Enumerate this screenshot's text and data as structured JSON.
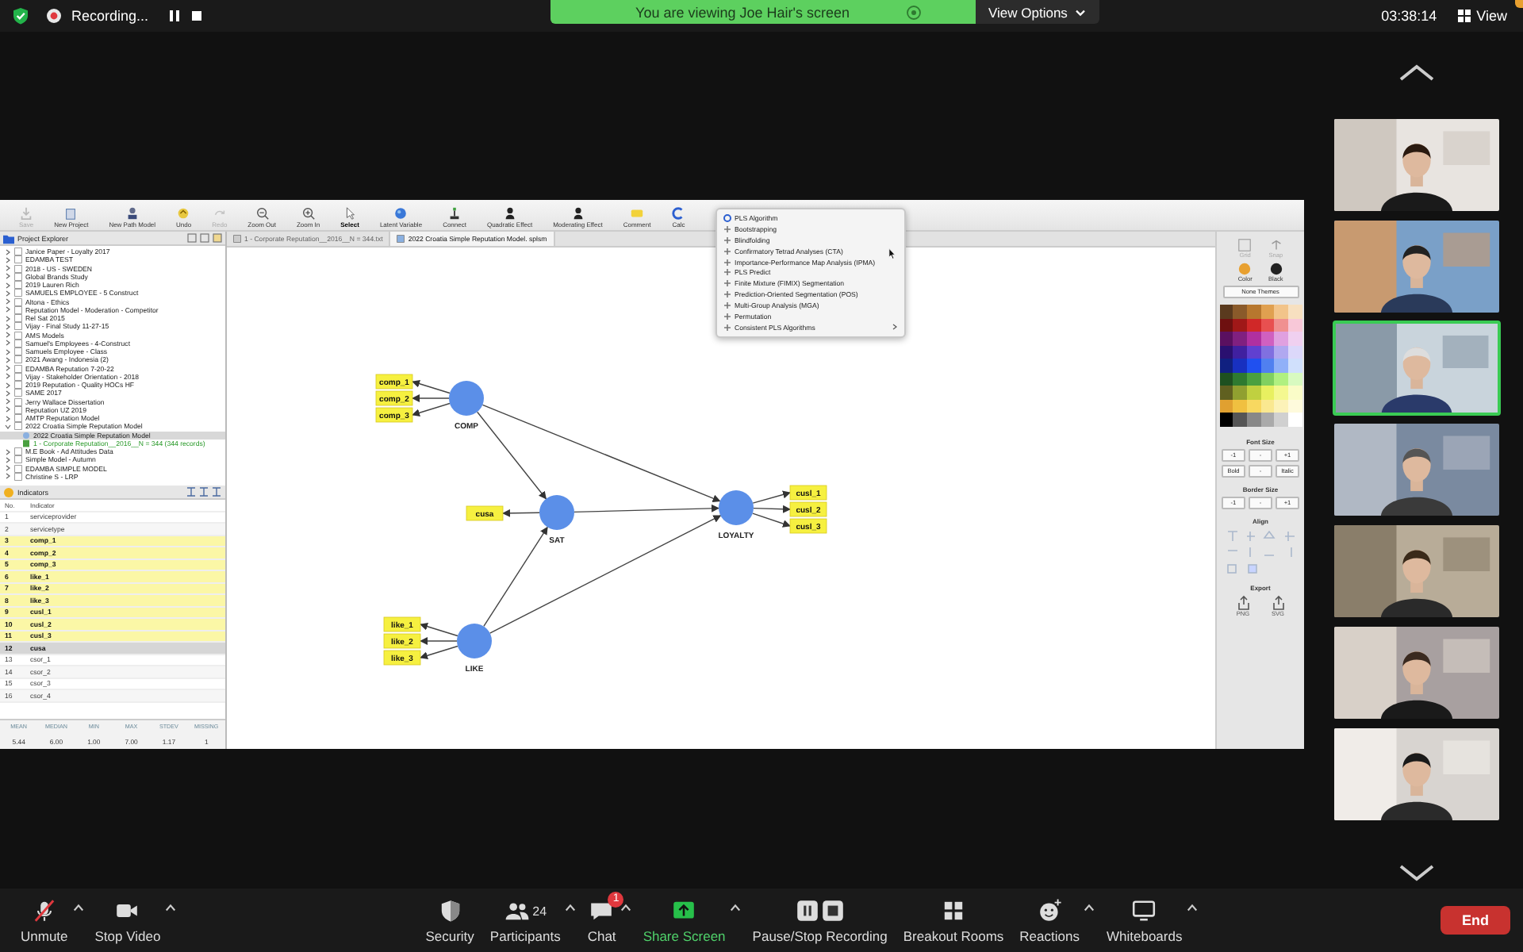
{
  "top_bar": {
    "recording_label": "Recording...",
    "banner": "You are viewing Joe Hair's screen",
    "view_options": "View Options",
    "time": "03:38:14",
    "view": "View"
  },
  "smartpls": {
    "toolbar": [
      {
        "label": "Save",
        "disabled": true,
        "selected": false
      },
      {
        "label": "New Project",
        "disabled": false,
        "selected": false
      },
      {
        "label": "New Path Model",
        "disabled": false,
        "selected": false
      },
      {
        "label": "Undo",
        "disabled": false,
        "selected": false
      },
      {
        "label": "Redo",
        "disabled": true,
        "selected": false
      },
      {
        "label": "Zoom Out",
        "disabled": false,
        "selected": false
      },
      {
        "label": "Zoom In",
        "disabled": false,
        "selected": false
      },
      {
        "label": "Select",
        "disabled": false,
        "selected": true
      },
      {
        "label": "Latent Variable",
        "disabled": false,
        "selected": false
      },
      {
        "label": "Connect",
        "disabled": false,
        "selected": false
      },
      {
        "label": "Quadratic Effect",
        "disabled": false,
        "selected": false
      },
      {
        "label": "Moderating Effect",
        "disabled": false,
        "selected": false
      },
      {
        "label": "Comment",
        "disabled": false,
        "selected": false
      },
      {
        "label": "Calc",
        "disabled": false,
        "selected": false
      }
    ],
    "project_explorer": {
      "title": "Project Explorer",
      "projects": [
        {
          "label": "Janice Paper - Loyalty 2017",
          "expanded": false
        },
        {
          "label": "EDAMBA TEST",
          "expanded": false
        },
        {
          "label": "2018 - US - SWEDEN",
          "expanded": false
        },
        {
          "label": "Global Brands Study",
          "expanded": false
        },
        {
          "label": "2019 Lauren Rich",
          "expanded": false
        },
        {
          "label": "SAMUELS EMPLOYEE - 5 Construct",
          "expanded": false
        },
        {
          "label": "Altona - Ethics",
          "expanded": false
        },
        {
          "label": "Reputation Model - Moderation - Competitor",
          "expanded": false
        },
        {
          "label": "Rel Sat 2015",
          "expanded": false
        },
        {
          "label": "Vijay - Final Study 11-27-15",
          "expanded": false
        },
        {
          "label": "AMS Models",
          "expanded": false
        },
        {
          "label": "Samuel's Employees - 4-Construct",
          "expanded": false
        },
        {
          "label": "Samuels Employee - Class",
          "expanded": false
        },
        {
          "label": "2021 Awang - Indonesia (2)",
          "expanded": false
        },
        {
          "label": "EDAMBA Reputation 7-20-22",
          "expanded": false
        },
        {
          "label": "Vijay - Stakeholder Orientation - 2018",
          "expanded": false
        },
        {
          "label": "2019 Reputation - Quality HOCs HF",
          "expanded": false
        },
        {
          "label": "SAME 2017",
          "expanded": false
        },
        {
          "label": "Jerry Wallace Dissertation",
          "expanded": false
        },
        {
          "label": "Reputation UZ 2019",
          "expanded": false
        },
        {
          "label": "AMTP Reputation Model",
          "expanded": false
        },
        {
          "label": "2022 Croatia Simple Reputation Model",
          "expanded": true,
          "children": [
            {
              "label": "2022 Croatia Simple Reputation Model",
              "kind": "model",
              "selected": true
            },
            {
              "label": "1 - Corporate Reputation__2016__N = 344 (344 records)",
              "kind": "data",
              "selected": false
            }
          ]
        },
        {
          "label": "M.E Book - Ad Attitudes Data",
          "expanded": false
        },
        {
          "label": "Simple Model - Autumn",
          "expanded": false
        },
        {
          "label": "EDAMBA SIMPLE MODEL",
          "expanded": false
        },
        {
          "label": "Christine S - LRP",
          "expanded": false
        }
      ]
    },
    "tabs": [
      {
        "label": "1 - Corporate Reputation__2016__N = 344.txt",
        "selected": false
      },
      {
        "label": "2022 Croatia Simple Reputation Model. splsm",
        "selected": true
      }
    ],
    "indicators": {
      "title": "Indicators",
      "columns": [
        "No.",
        "Indicator"
      ],
      "rows": [
        {
          "no": "1",
          "name": "serviceprovider",
          "in_model": false,
          "selected": false
        },
        {
          "no": "2",
          "name": "servicetype",
          "in_model": false,
          "selected": false
        },
        {
          "no": "3",
          "name": "comp_1",
          "in_model": true,
          "selected": false
        },
        {
          "no": "4",
          "name": "comp_2",
          "in_model": true,
          "selected": false
        },
        {
          "no": "5",
          "name": "comp_3",
          "in_model": true,
          "selected": false
        },
        {
          "no": "6",
          "name": "like_1",
          "in_model": true,
          "selected": false
        },
        {
          "no": "7",
          "name": "like_2",
          "in_model": true,
          "selected": false
        },
        {
          "no": "8",
          "name": "like_3",
          "in_model": true,
          "selected": false
        },
        {
          "no": "9",
          "name": "cusl_1",
          "in_model": true,
          "selected": false
        },
        {
          "no": "10",
          "name": "cusl_2",
          "in_model": true,
          "selected": false
        },
        {
          "no": "11",
          "name": "cusl_3",
          "in_model": true,
          "selected": false
        },
        {
          "no": "12",
          "name": "cusa",
          "in_model": false,
          "selected": true
        },
        {
          "no": "13",
          "name": "csor_1",
          "in_model": false,
          "selected": false
        },
        {
          "no": "14",
          "name": "csor_2",
          "in_model": false,
          "selected": false
        },
        {
          "no": "15",
          "name": "csor_3",
          "in_model": false,
          "selected": false
        },
        {
          "no": "16",
          "name": "csor_4",
          "in_model": false,
          "selected": false
        }
      ]
    },
    "stats": {
      "columns": [
        "MEAN",
        "MEDIAN",
        "MIN",
        "MAX",
        "STDEV",
        "MISSING"
      ],
      "values": [
        "5.44",
        "6.00",
        "1.00",
        "7.00",
        "1.17",
        "1"
      ]
    },
    "model": {
      "constructs": [
        {
          "label": "COMP",
          "indicators": [
            "comp_1",
            "comp_2",
            "comp_3"
          ]
        },
        {
          "label": "SAT",
          "indicators": [
            "cusa"
          ]
        },
        {
          "label": "LOYALTY",
          "indicators": [
            "cusl_1",
            "cusl_2",
            "cusl_3"
          ]
        },
        {
          "label": "LIKE",
          "indicators": [
            "like_1",
            "like_2",
            "like_3"
          ]
        }
      ]
    },
    "calculate_menu": [
      {
        "label": "PLS Algorithm",
        "highlighted": true,
        "submenu": false
      },
      {
        "label": "Bootstrapping",
        "highlighted": false,
        "submenu": false
      },
      {
        "label": "Blindfolding",
        "highlighted": false,
        "submenu": false
      },
      {
        "label": "Confirmatory Tetrad Analyses (CTA)",
        "highlighted": false,
        "submenu": false
      },
      {
        "label": "Importance-Performance Map Analysis (IPMA)",
        "highlighted": false,
        "submenu": false
      },
      {
        "label": "PLS Predict",
        "highlighted": false,
        "submenu": false
      },
      {
        "label": "Finite Mixture (FIMIX) Segmentation",
        "highlighted": false,
        "submenu": false
      },
      {
        "label": "Prediction-Oriented Segmentation (POS)",
        "highlighted": false,
        "submenu": false
      },
      {
        "label": "Multi-Group Analysis (MGA)",
        "highlighted": false,
        "submenu": false
      },
      {
        "label": "Permutation",
        "highlighted": false,
        "submenu": false
      },
      {
        "label": "Consistent PLS Algorithms",
        "highlighted": false,
        "submenu": true
      }
    ],
    "right_panel": {
      "tools": [
        {
          "label": "Grid",
          "disabled": true
        },
        {
          "label": "Snap",
          "disabled": true
        },
        {
          "label": "Color",
          "disabled": false
        },
        {
          "label": "Black",
          "disabled": false
        }
      ],
      "theme_button": "None Themes",
      "font_size": {
        "title": "Font Size",
        "buttons": [
          "-1",
          "-",
          "+1",
          "Bold",
          "-",
          "Italic"
        ]
      },
      "border_size": {
        "title": "Border Size",
        "buttons": [
          "-1",
          "-",
          "+1"
        ]
      },
      "align_title": "Align",
      "export": {
        "title": "Export",
        "buttons": [
          "PNG",
          "SVG"
        ]
      }
    }
  },
  "gallery": [
    {
      "kind": "picture",
      "speaking": false
    },
    {
      "kind": "picture",
      "speaking": false
    },
    {
      "kind": "picture",
      "speaking": true
    },
    {
      "kind": "picture",
      "speaking": false
    },
    {
      "kind": "picture",
      "speaking": false
    },
    {
      "kind": "picture",
      "speaking": false
    },
    {
      "kind": "picture",
      "speaking": false
    }
  ],
  "meeting_controls": [
    {
      "label": "Unmute",
      "kind": "mic-muted",
      "caret": true
    },
    {
      "label": "Stop Video",
      "kind": "video",
      "caret": true
    },
    {
      "label": "Security",
      "kind": "security",
      "caret": false
    },
    {
      "label": "Participants",
      "kind": "participants",
      "caret": true,
      "count": "24"
    },
    {
      "label": "Chat",
      "kind": "chat",
      "caret": true,
      "badge": "1"
    },
    {
      "label": "Share Screen",
      "kind": "share",
      "caret": true,
      "active": true
    },
    {
      "label": "Pause/Stop Recording",
      "kind": "recording",
      "caret": false
    },
    {
      "label": "Breakout Rooms",
      "kind": "breakout",
      "caret": false
    },
    {
      "label": "Reactions",
      "kind": "reactions",
      "caret": true
    },
    {
      "label": "Whiteboards",
      "kind": "whiteboard",
      "caret": true
    }
  ],
  "end_button": "End"
}
